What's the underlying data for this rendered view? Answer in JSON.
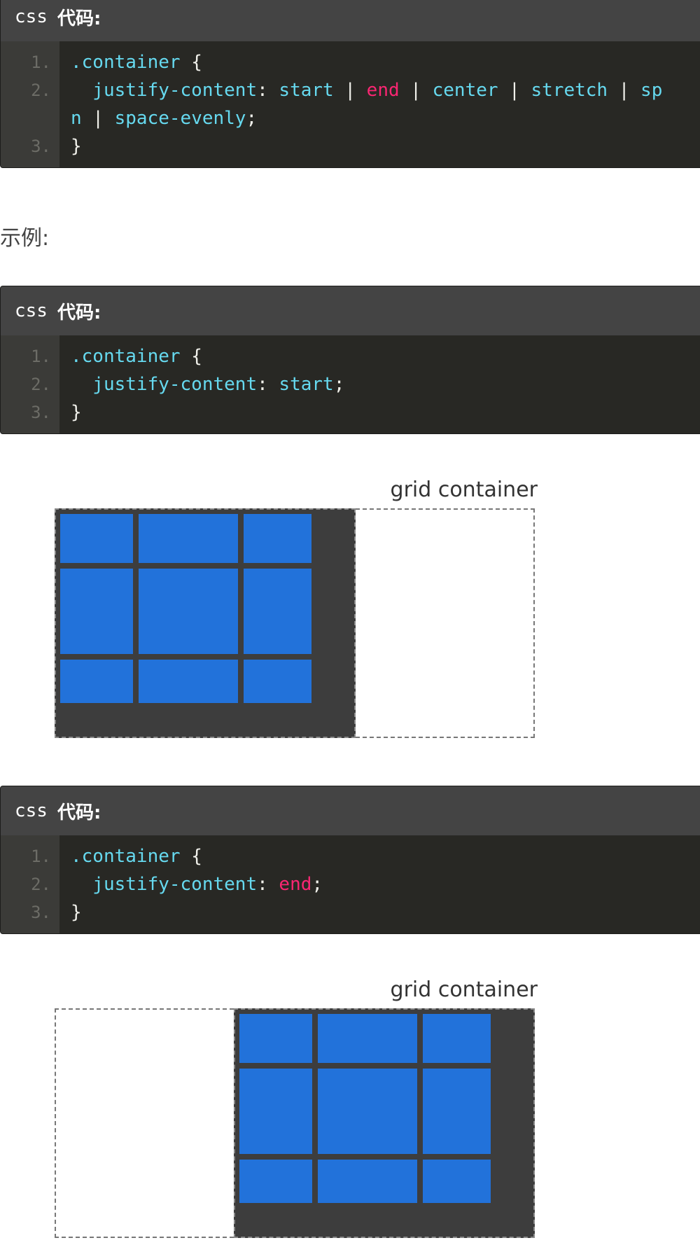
{
  "blocks": [
    {
      "header": {
        "lang": "css",
        "title": "代码:"
      },
      "lines": [
        [
          {
            "t": ".container",
            "c": "t-sel"
          },
          {
            "t": " {",
            "c": "t-punc"
          }
        ],
        [
          {
            "t": "  justify-content",
            "c": "t-prop"
          },
          {
            "t": ": ",
            "c": "t-punc"
          },
          {
            "t": "start",
            "c": "t-val"
          },
          {
            "t": " | ",
            "c": "t-punc"
          },
          {
            "t": "end",
            "c": "t-kw"
          },
          {
            "t": " | ",
            "c": "t-punc"
          },
          {
            "t": "center",
            "c": "t-val"
          },
          {
            "t": " | ",
            "c": "t-punc"
          },
          {
            "t": "stretch",
            "c": "t-val"
          },
          {
            "t": " | ",
            "c": "t-punc"
          },
          {
            "t": "sp",
            "c": "t-val"
          }
        ],
        [
          {
            "t": "n",
            "c": "t-val"
          },
          {
            "t": " | ",
            "c": "t-punc"
          },
          {
            "t": "space-evenly",
            "c": "t-val"
          },
          {
            "t": ";",
            "c": "t-punc"
          }
        ],
        [
          {
            "t": "}",
            "c": "t-punc"
          }
        ]
      ],
      "line_numbers": [
        "1.",
        "2.",
        "3."
      ]
    },
    {
      "header": {
        "lang": "css",
        "title": "代码:"
      },
      "lines": [
        [
          {
            "t": ".container",
            "c": "t-sel"
          },
          {
            "t": " {",
            "c": "t-punc"
          }
        ],
        [
          {
            "t": "  justify-content",
            "c": "t-prop"
          },
          {
            "t": ": ",
            "c": "t-punc"
          },
          {
            "t": "start",
            "c": "t-val"
          },
          {
            "t": ";",
            "c": "t-punc"
          }
        ],
        [
          {
            "t": "}",
            "c": "t-punc"
          }
        ]
      ],
      "line_numbers": [
        "1.",
        "2.",
        "3."
      ]
    },
    {
      "header": {
        "lang": "css",
        "title": "代码:"
      },
      "lines": [
        [
          {
            "t": ".container",
            "c": "t-sel"
          },
          {
            "t": " {",
            "c": "t-punc"
          }
        ],
        [
          {
            "t": "  justify-content",
            "c": "t-prop"
          },
          {
            "t": ": ",
            "c": "t-punc"
          },
          {
            "t": "end",
            "c": "t-kw"
          },
          {
            "t": ";",
            "c": "t-punc"
          }
        ],
        [
          {
            "t": "}",
            "c": "t-punc"
          }
        ]
      ],
      "line_numbers": [
        "1.",
        "2.",
        "3."
      ]
    }
  ],
  "example_label": "示例:",
  "figures": [
    {
      "label": "grid container",
      "justify": "start"
    },
    {
      "label": "grid container",
      "justify": "end"
    }
  ],
  "colors": {
    "cell": "#2272da",
    "track": "#3d3d3d",
    "code_bg": "#282824"
  }
}
